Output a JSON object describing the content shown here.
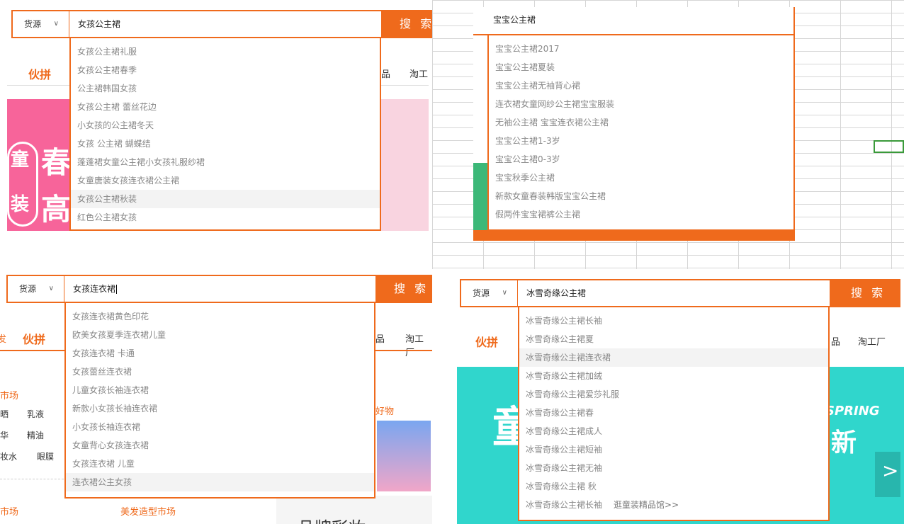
{
  "common": {
    "source_label": "货源",
    "search_label": "搜 索"
  },
  "panel1": {
    "query": "女孩公主裙",
    "nav_left": "伙拼",
    "nav_right1": "品",
    "nav_right2": "淘工",
    "banner_char1": "童",
    "banner_char2": "装",
    "banner_big1": "春",
    "banner_big2": "高",
    "suggestions": [
      "女孩公主裙礼服",
      "女孩公主裙春季",
      "公主裙韩国女孩",
      "女孩公主裙 蕾丝花边",
      "小女孩的公主裙冬天",
      "女孩 公主裙 蝴蝶结",
      "蓬蓬裙女童公主裙小女孩礼服纱裙",
      "女童唐装女孩连衣裙公主裙",
      "女孩公主裙秋装",
      "红色公主裙女孩"
    ],
    "highlight_index": 8
  },
  "panel2": {
    "query": "宝宝公主裙",
    "suggestions": [
      "宝宝公主裙2017",
      "宝宝公主裙夏装",
      "宝宝公主裙无袖背心裙",
      "连衣裙女童网纱公主裙宝宝服装",
      "无袖公主裙 宝宝连衣裙公主裙",
      "宝宝公主裙1-3岁",
      "宝宝公主裙0-3岁",
      "宝宝秋季公主裙",
      "新款女童春装韩版宝宝公主裙",
      "假两件宝宝裙裤公主裙"
    ]
  },
  "panel3": {
    "query": "女孩连衣裙",
    "nav_left": "伙拼",
    "nav_left_partial": "发",
    "nav_right1": "品",
    "nav_right2": "淘工厂",
    "market1": "市场",
    "market2": "市场",
    "market3": "美发造型市场",
    "goods_partial": "好物",
    "cats": [
      "晒",
      "乳液",
      "华",
      "精油",
      "妆水",
      "眼膜"
    ],
    "brand_partial": "品牌彩妆",
    "suggestions": [
      "女孩连衣裙黄色印花",
      "欧美女孩夏季连衣裙儿童",
      "女孩连衣裙 卡通",
      "女孩蕾丝连衣裙",
      "儿童女孩长袖连衣裙",
      "新款小女孩长袖连衣裙",
      "小女孩长袖连衣裙",
      "女童背心女孩连衣裙",
      "女孩连衣裙 儿童",
      "连衣裙公主女孩"
    ],
    "highlight_index": 9
  },
  "panel4": {
    "query": "冰雪奇缘公主裙",
    "nav_left": "伙拼",
    "nav_right1": "品",
    "nav_right2": "淘工厂",
    "banner_text1": "童",
    "banner_text2": "新",
    "banner_small": "SPRING",
    "suggestions": [
      "冰雪奇缘公主裙长袖",
      "冰雪奇缘公主裙夏",
      "冰雪奇缘公主裙连衣裙",
      "冰雪奇缘公主裙加绒",
      "冰雪奇缘公主裙爱莎礼服",
      "冰雪奇缘公主裙春",
      "冰雪奇缘公主裙成人",
      "冰雪奇缘公主裙短袖",
      "冰雪奇缘公主裙无袖",
      "冰雪奇缘公主裙 秋",
      "冰雪奇缘公主裙长袖"
    ],
    "last_extra": "逛童装精品馆>>",
    "highlight_index": 2
  }
}
